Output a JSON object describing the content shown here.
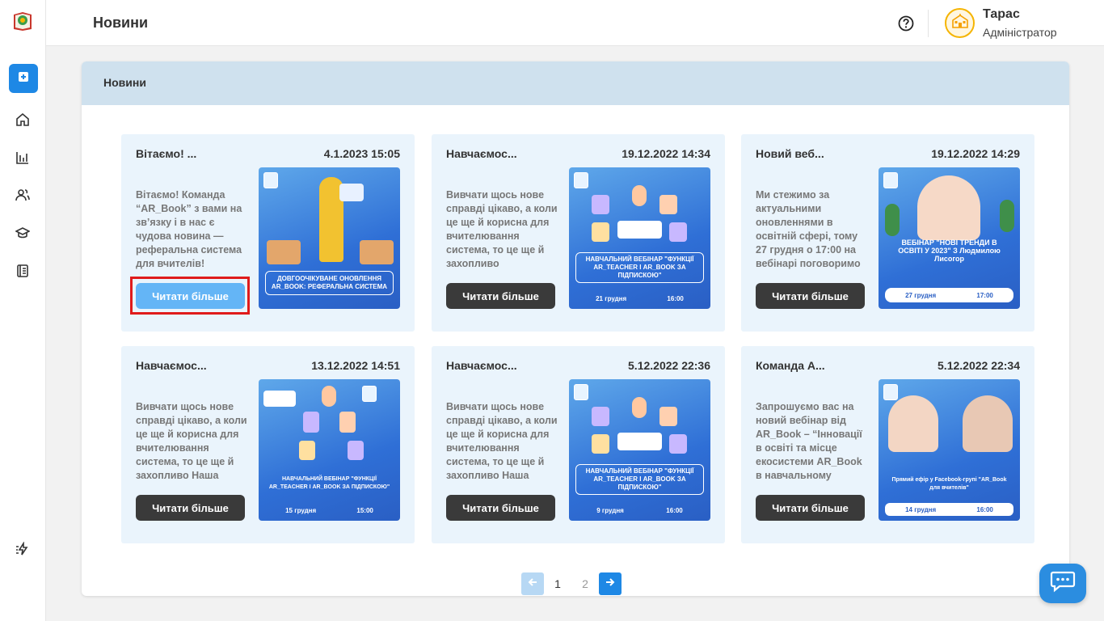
{
  "header": {
    "title": "Новини",
    "user_name": "Тарас",
    "user_role": "Адміністратор"
  },
  "panel": {
    "title": "Новини"
  },
  "cards": [
    {
      "title": "Вітаємо! ...",
      "date": "4.1.2023 15:05",
      "text": "Вітаємо! Команда “AR_Book” з вами на зв’язку і в нас є чудова новина — реферальна система для вчителів! Розіграш та подарунки",
      "button": "Читати більше",
      "image_caption": "ДОВГООЧІКУВАНЕ ОНОВЛЕННЯ AR_BOOK: РЕФЕРАЛЬНА СИСТЕМА",
      "image_bottom": []
    },
    {
      "title": "Навчаємос...",
      "date": "19.12.2022 14:34",
      "text": "Вивчати щось нове справді цікаво, а коли це ще й корисна для вчителювання система, то це ще й захопливо ",
      "button": "Читати більше",
      "image_caption": "НАВЧАЛЬНИЙ ВЕБІНАР \"ФУНКЦІЇ AR_TEACHER І AR_BOOK ЗА ПІДПИСКОЮ\"",
      "image_bottom": [
        "21 грудня",
        "16:00"
      ]
    },
    {
      "title": "Новий веб...",
      "date": "19.12.2022 14:29",
      "text": "Ми стежимо за актуальними оновленнями в освітній сфері, тому 27 грудня о 17:00 на вебінарі поговоримо",
      "button": "Читати більше",
      "image_caption": "ВЕБІНАР \"НОВІ ТРЕНДИ В ОСВІТІ У 2023\" З Людмилою Лисогор",
      "image_bottom": [
        "27 грудня",
        "17:00"
      ]
    },
    {
      "title": "Навчаємос...",
      "date": "13.12.2022 14:51",
      "text": "Вивчати щось нове справді цікаво, а коли це ще й корисна для вчителювання система, то це ще й захопливо  Наша команда завжди",
      "button": "Читати більше",
      "image_caption": "НАВЧАЛЬНИЙ ВЕБІНАР \"ФУНКЦІЇ AR_TEACHER І AR_BOOK ЗА ПІДПИСКОЮ\"",
      "image_bottom": [
        "15 грудня",
        "15:00"
      ]
    },
    {
      "title": "Навчаємос...",
      "date": "5.12.2022 22:36",
      "text": "Вивчати щось нове справді цікаво, а коли це ще й корисна для вчителювання система, то це ще й захопливо  Наша команда завжди",
      "button": "Читати більше",
      "image_caption": "НАВЧАЛЬНИЙ ВЕБІНАР \"ФУНКЦІЇ AR_TEACHER І AR_BOOK ЗА ПІДПИСКОЮ\"",
      "image_bottom": [
        "9 грудня",
        "16:00"
      ]
    },
    {
      "title": "Команда А...",
      "date": "5.12.2022 22:34",
      "text": "Запрошуємо вас на новий вебінар від AR_Book – “Інновації в освіті та місце екосистеми AR_Book в навчальному процесі",
      "button": "Читати більше",
      "image_caption": "Прямий ефір у Facebook-групі \"AR_Book для вчителів\"",
      "image_bottom": [
        "14 грудня",
        "16:00"
      ]
    }
  ],
  "pagination": {
    "pages": [
      "1",
      "2"
    ],
    "current": "1"
  },
  "colors": {
    "accent": "#1e88e5",
    "card_bg": "#eaf4fc",
    "panel_head": "#cfe1ee",
    "button_dark": "#3a3a3a",
    "button_active": "#64b5f6",
    "highlight": "#e01b1b"
  },
  "icons": {
    "sidebar": [
      "app-logo-icon",
      "plus-icon",
      "home-icon",
      "chart-icon",
      "users-icon",
      "graduation-cap-icon",
      "book-icon",
      "zap-icon"
    ],
    "header": [
      "help-icon",
      "school-building-icon"
    ],
    "floating": "chat-icon"
  }
}
